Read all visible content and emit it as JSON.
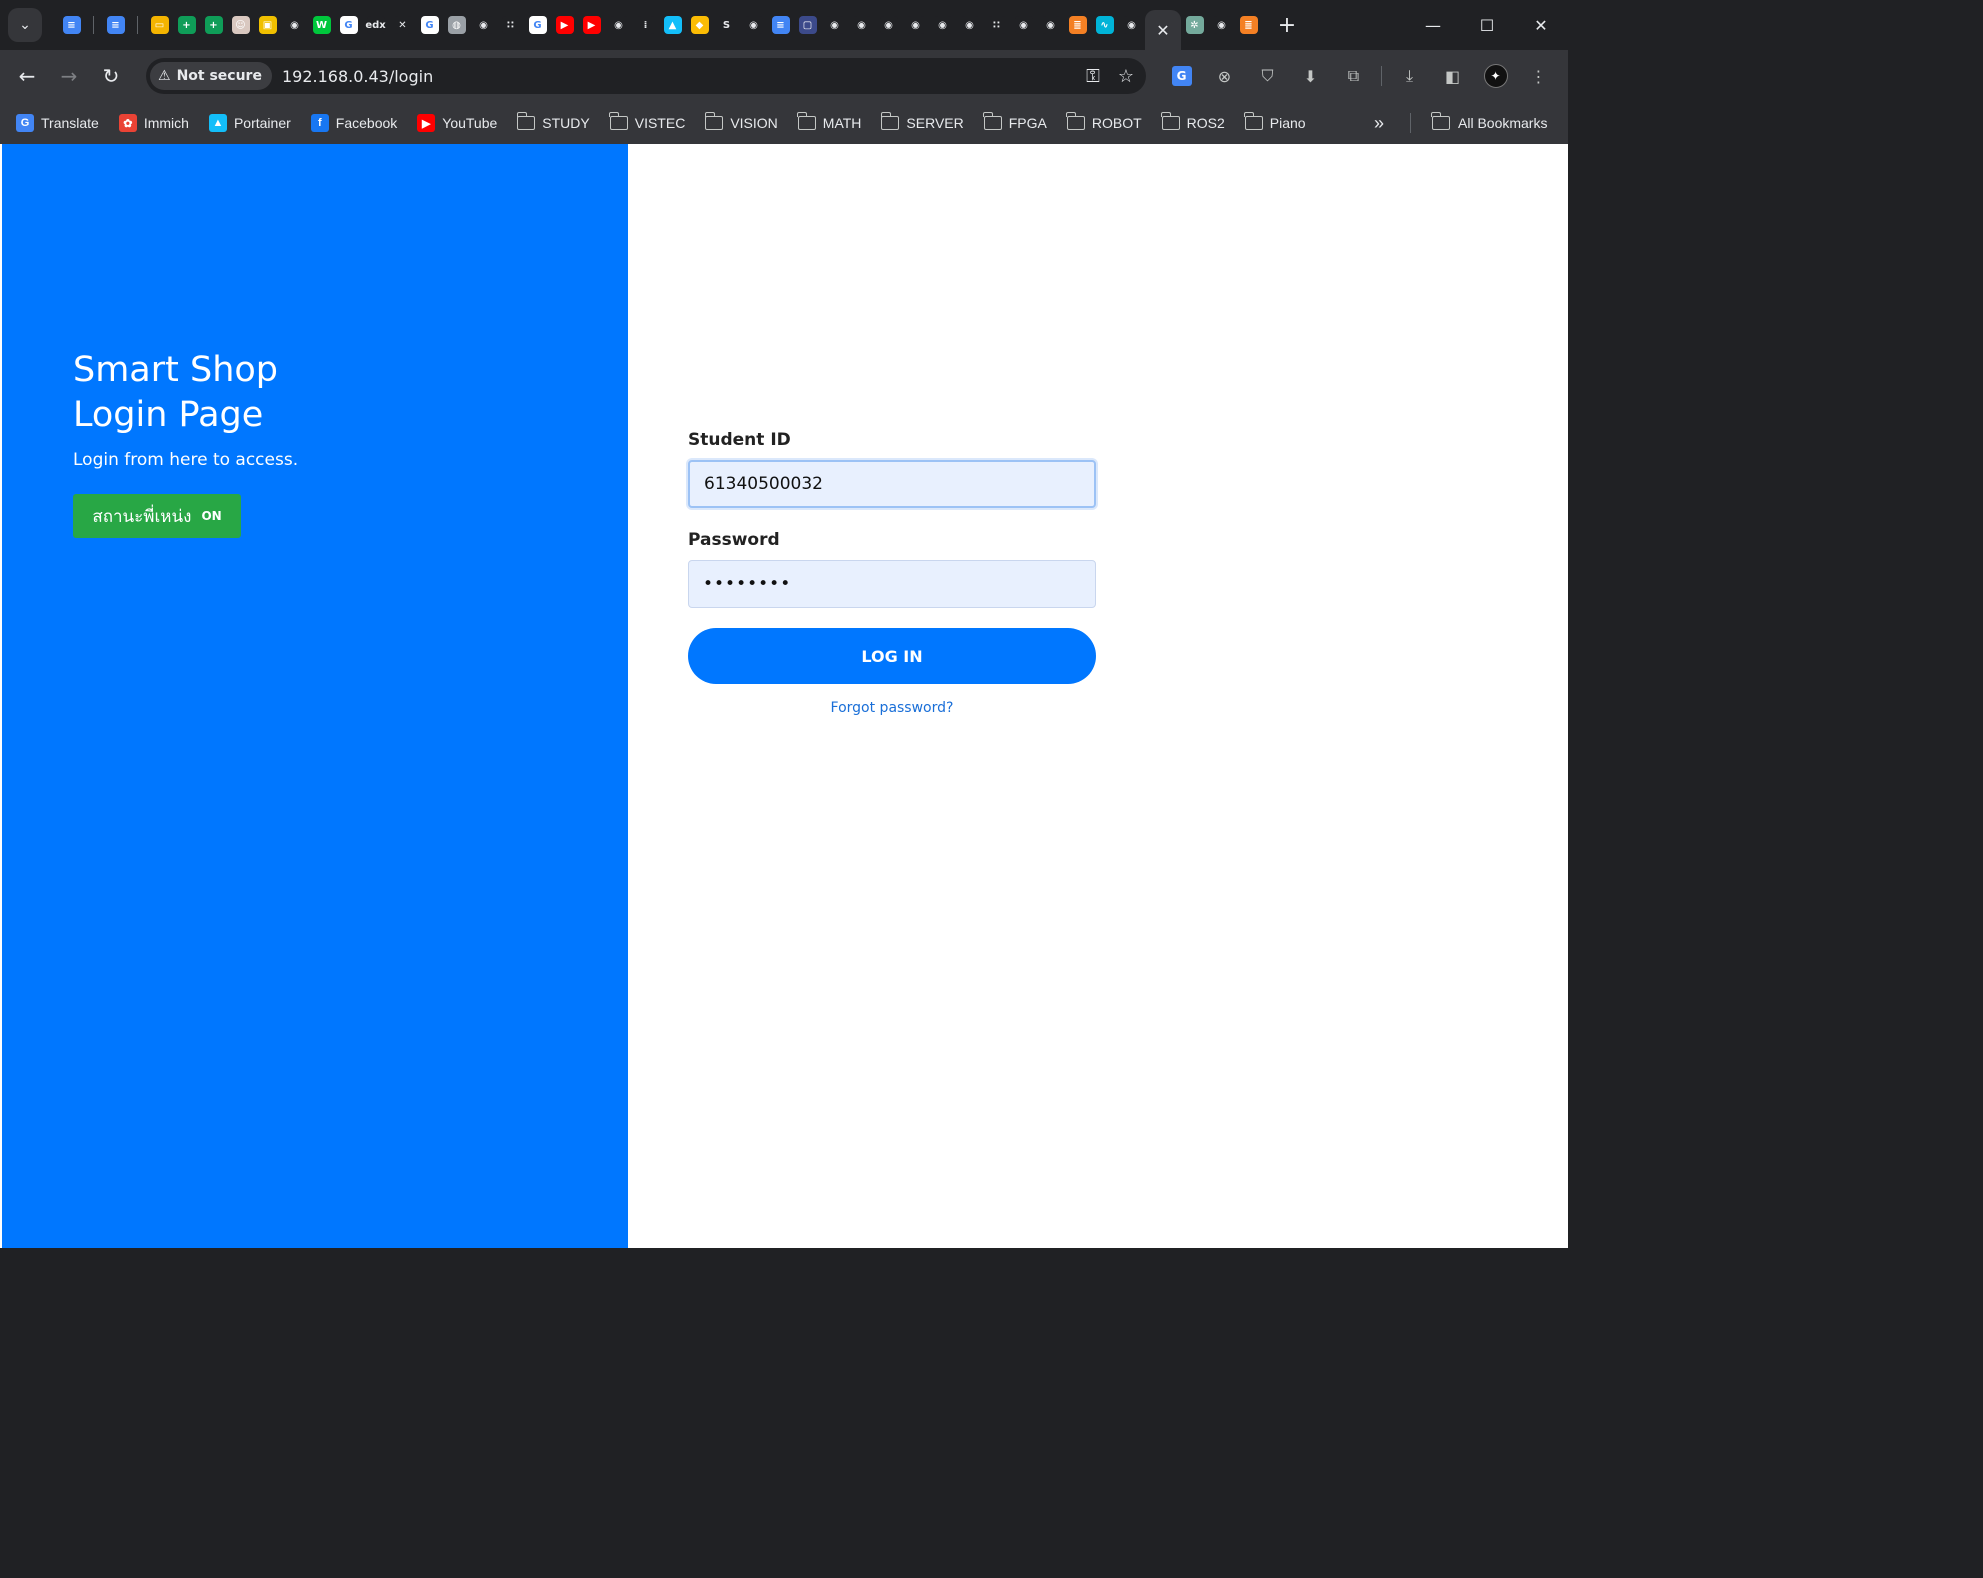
{
  "browser": {
    "tab_search_icon": "chevron-down-icon",
    "active_tab_close": "✕",
    "new_tab": "+",
    "tabs": [
      {
        "icon": "google-docs-icon",
        "color": "#4285f4",
        "glyph": "≡"
      },
      {
        "icon": "google-docs-icon",
        "color": "#4285f4",
        "glyph": "≡"
      },
      {
        "icon": "google-slides-icon",
        "color": "#f4b400",
        "glyph": "▭"
      },
      {
        "icon": "google-sheets-icon",
        "color": "#0f9d58",
        "glyph": "+"
      },
      {
        "icon": "google-sheets-icon",
        "color": "#0f9d58",
        "glyph": "+"
      },
      {
        "icon": "anime-avatar-icon",
        "color": "#d9c8c0",
        "glyph": "☺"
      },
      {
        "icon": "robot-icon",
        "color": "#f0c000",
        "glyph": "▣"
      },
      {
        "icon": "github-icon",
        "color": "#202124",
        "glyph": "◉"
      },
      {
        "icon": "webtoon-icon",
        "color": "#00c73c",
        "glyph": "W"
      },
      {
        "icon": "google-icon",
        "color": "#ffffff",
        "glyph": "G"
      },
      {
        "icon": "edx-icon",
        "color": "#202124",
        "glyph": "edx"
      },
      {
        "icon": "x-icon",
        "color": "#202124",
        "glyph": "✕"
      },
      {
        "icon": "google-icon",
        "color": "#ffffff",
        "glyph": "G"
      },
      {
        "icon": "globe-icon",
        "color": "#9aa0a6",
        "glyph": "◍"
      },
      {
        "icon": "github-icon",
        "color": "#202124",
        "glyph": "◉"
      },
      {
        "icon": "blank-tab-icon",
        "color": "#202124",
        "glyph": "∷"
      },
      {
        "icon": "google-icon",
        "color": "#ffffff",
        "glyph": "G"
      },
      {
        "icon": "youtube-icon",
        "color": "#ff0000",
        "glyph": "▶"
      },
      {
        "icon": "youtube-icon",
        "color": "#ff0000",
        "glyph": "▶"
      },
      {
        "icon": "github-icon",
        "color": "#202124",
        "glyph": "◉"
      },
      {
        "icon": "dots-grid-icon",
        "color": "#202124",
        "glyph": "⁞"
      },
      {
        "icon": "portainer-icon",
        "color": "#13bef9",
        "glyph": "▲"
      },
      {
        "icon": "google-keep-icon",
        "color": "#fbbc04",
        "glyph": "◆"
      },
      {
        "icon": "red-s-icon",
        "color": "#202124",
        "glyph": "S"
      },
      {
        "icon": "github-icon",
        "color": "#202124",
        "glyph": "◉"
      },
      {
        "icon": "google-docs-icon",
        "color": "#4285f4",
        "glyph": "≡"
      },
      {
        "icon": "monitor-icon",
        "color": "#3c4a8a",
        "glyph": "▢"
      },
      {
        "icon": "github-icon",
        "color": "#202124",
        "glyph": "◉"
      },
      {
        "icon": "github-icon",
        "color": "#202124",
        "glyph": "◉"
      },
      {
        "icon": "github-icon",
        "color": "#202124",
        "glyph": "◉"
      },
      {
        "icon": "github-icon",
        "color": "#202124",
        "glyph": "◉"
      },
      {
        "icon": "github-icon",
        "color": "#202124",
        "glyph": "◉"
      },
      {
        "icon": "github-icon",
        "color": "#202124",
        "glyph": "◉"
      },
      {
        "icon": "blank-tab-icon",
        "color": "#202124",
        "glyph": "∷"
      },
      {
        "icon": "github-icon",
        "color": "#202124",
        "glyph": "◉"
      },
      {
        "icon": "github-icon",
        "color": "#202124",
        "glyph": "◉"
      },
      {
        "icon": "stackoverflow-icon",
        "color": "#f48024",
        "glyph": "≣"
      },
      {
        "icon": "wave-icon",
        "color": "#00b4d8",
        "glyph": "∿"
      },
      {
        "icon": "github-icon",
        "color": "#202124",
        "glyph": "◉"
      }
    ],
    "after_tabs": [
      {
        "icon": "chatgpt-icon",
        "color": "#74aa9c",
        "glyph": "✲"
      },
      {
        "icon": "github-icon",
        "color": "#202124",
        "glyph": "◉"
      },
      {
        "icon": "stackoverflow-icon",
        "color": "#f48024",
        "glyph": "≣"
      }
    ],
    "security_label": "Not secure",
    "url": "192.168.0.43/login",
    "bookmarks": [
      {
        "label": "Translate",
        "icon": "google-translate-icon",
        "color": "#4285f4",
        "glyph": "G"
      },
      {
        "label": "Immich",
        "icon": "immich-icon",
        "color": "#ea4335",
        "glyph": "✿"
      },
      {
        "label": "Portainer",
        "icon": "portainer-icon",
        "color": "#13bef9",
        "glyph": "▲"
      },
      {
        "label": "Facebook",
        "icon": "facebook-icon",
        "color": "#1877f2",
        "glyph": "f"
      },
      {
        "label": "YouTube",
        "icon": "youtube-icon",
        "color": "#ff0000",
        "glyph": "▶"
      }
    ],
    "bookmark_folders": [
      "STUDY",
      "VISTEC",
      "VISION",
      "MATH",
      "SERVER",
      "FPGA",
      "ROBOT",
      "ROS2",
      "Piano"
    ],
    "bookmarks_more": "»",
    "all_bookmarks": "All Bookmarks"
  },
  "page": {
    "hero_title_line1": "Smart Shop",
    "hero_title_line2": "Login Page",
    "hero_subtitle": "Login from here to access.",
    "status_label": "สถานะพี่เหน่ง",
    "status_state": "ON",
    "student_id_label": "Student ID",
    "student_id_value": "61340500032",
    "password_label": "Password",
    "password_value": "••••••••",
    "login_button": "LOG IN",
    "forgot_link": "Forgot password?",
    "accent_color": "#0077ff",
    "status_color": "#28a745"
  }
}
